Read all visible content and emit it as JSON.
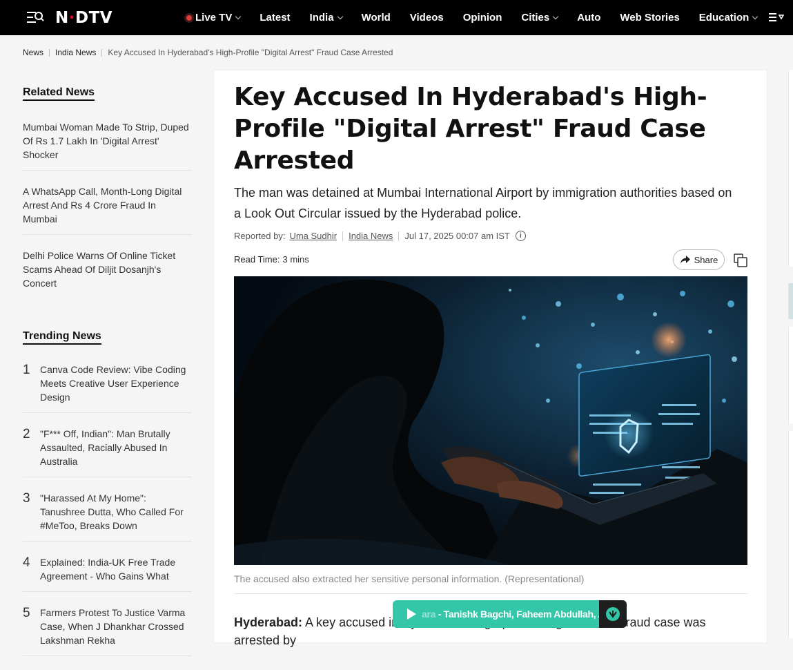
{
  "header": {
    "logo_text_1": "N",
    "logo_text_2": "DTV",
    "nav": [
      {
        "label": "Live TV",
        "has_dropdown": true,
        "live": true
      },
      {
        "label": "Latest",
        "has_dropdown": false
      },
      {
        "label": "India",
        "has_dropdown": true
      },
      {
        "label": "World",
        "has_dropdown": false
      },
      {
        "label": "Videos",
        "has_dropdown": false
      },
      {
        "label": "Opinion",
        "has_dropdown": false
      },
      {
        "label": "Cities",
        "has_dropdown": true
      },
      {
        "label": "Auto",
        "has_dropdown": false
      },
      {
        "label": "Web Stories",
        "has_dropdown": false
      },
      {
        "label": "Education",
        "has_dropdown": true
      }
    ]
  },
  "breadcrumb": {
    "items": [
      "News",
      "India News"
    ],
    "current": "Key Accused In Hyderabad's High-Profile \"Digital Arrest\" Fraud Case Arrested"
  },
  "sidebar": {
    "related_heading": "Related News",
    "related": [
      "Mumbai Woman Made To Strip, Duped Of Rs 1.7 Lakh In 'Digital Arrest' Shocker",
      "A WhatsApp Call, Month-Long Digital Arrest And Rs 4 Crore Fraud In Mumbai",
      "Delhi Police Warns Of Online Ticket Scams Ahead Of Diljit Dosanjh's Concert"
    ],
    "trending_heading": "Trending News",
    "trending": [
      {
        "num": "1",
        "title": "Canva Code Review: Vibe Coding Meets Creative User Experience Design"
      },
      {
        "num": "2",
        "title": "\"F*** Off, Indian\": Man Brutally Assaulted, Racially Abused In Australia"
      },
      {
        "num": "3",
        "title": "\"Harassed At My Home\": Tanushree Dutta, Who Called For #MeToo, Breaks Down"
      },
      {
        "num": "4",
        "title": "Explained: India-UK Free Trade Agreement - Who Gains What"
      },
      {
        "num": "5",
        "title": "Farmers Protest To Justice Varma Case, When J Dhankhar Crossed Lakshman Rekha"
      }
    ]
  },
  "article": {
    "headline": "Key Accused In Hyderabad's High-Profile \"Digital Arrest\" Fraud Case Arrested",
    "dek": "The man was detained at Mumbai International Airport by immigration authorities based on a Look Out Circular issued by the Hyderabad police.",
    "reported_by_label": "Reported by:",
    "author": "Uma Sudhir",
    "section": "India News",
    "timestamp": "Jul 17, 2025 00:07 am IST",
    "read_time_label": "Read Time:",
    "read_time": "3 mins",
    "share_label": "Share",
    "caption": "The accused also extracted her sensitive personal information. (Representational)",
    "lede_bold": "Hyderabad:",
    "lede_text": " A key accused in Hyderabad's high-profile \"Digital Arrest\" fraud case was arrested by"
  },
  "player": {
    "track_faded": "ara",
    "track": " - Tanishk Bagchi, Faheem Abdullah, A"
  },
  "colors": {
    "nav_bg": "#000000",
    "logo_red": "#e4002b",
    "player_bg": "#34c6a9"
  }
}
